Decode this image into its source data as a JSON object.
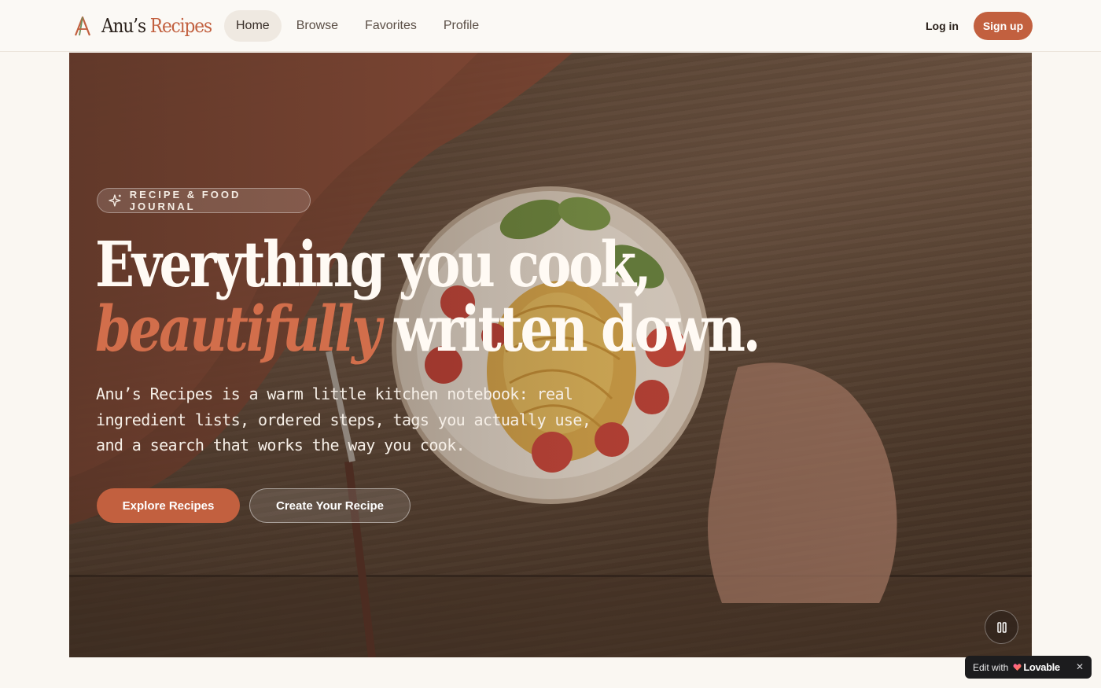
{
  "header": {
    "brand": {
      "part1": "Anu’s",
      "part2": "Recipes",
      "logo_icon": "letter-a-logo-icon"
    },
    "nav": [
      {
        "label": "Home",
        "active": true
      },
      {
        "label": "Browse",
        "active": false
      },
      {
        "label": "Favorites",
        "active": false
      },
      {
        "label": "Profile",
        "active": false
      }
    ],
    "login_label": "Log in",
    "signup_label": "Sign up"
  },
  "hero": {
    "eyebrow": "RECIPE & FOOD JOURNAL",
    "eyebrow_icon": "sparkles-icon",
    "headline_line1": "Everything you cook,",
    "headline_accent": "beautifully",
    "headline_rest": "written down.",
    "description": "Anu’s Recipes is a warm little kitchen notebook: real ingredient lists, ordered steps, tags you actually use, and a search that works the way you cook.",
    "primary_cta": "Explore Recipes",
    "secondary_cta": "Create Your Recipe",
    "pause_icon": "pause-icon",
    "background": "video-still-pasta-plate-on-wooden-table"
  },
  "badge": {
    "label": "Edit with",
    "brand": "Lovable",
    "close_icon": "close-icon"
  },
  "colors": {
    "accent": "#c2603f",
    "page_bg": "#faf7f2",
    "text_dark": "#2a211b"
  }
}
